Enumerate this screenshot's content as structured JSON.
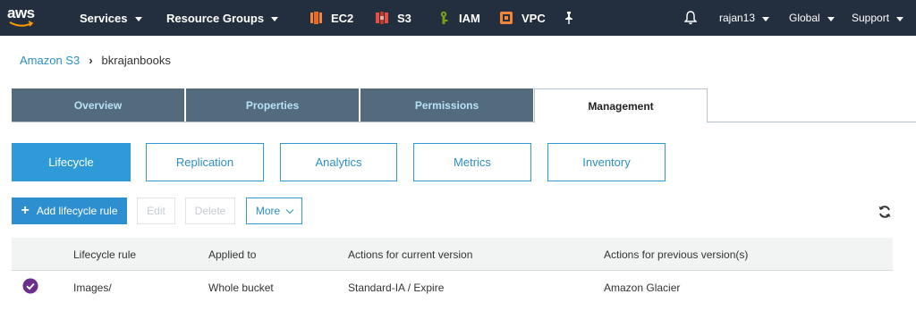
{
  "nav": {
    "logo": "aws",
    "services_label": "Services",
    "resource_groups_label": "Resource Groups",
    "shortcuts": [
      {
        "label": "EC2",
        "icon": "ec2-icon"
      },
      {
        "label": "S3",
        "icon": "s3-icon"
      },
      {
        "label": "IAM",
        "icon": "iam-icon"
      },
      {
        "label": "VPC",
        "icon": "vpc-icon"
      }
    ],
    "pin_icon": "pin-icon",
    "bell_icon": "bell-icon",
    "user_label": "rajan13",
    "region_label": "Global",
    "support_label": "Support"
  },
  "breadcrumb": {
    "root": "Amazon S3",
    "current": "bkrajanbooks"
  },
  "tabs": [
    {
      "label": "Overview",
      "active": false
    },
    {
      "label": "Properties",
      "active": false
    },
    {
      "label": "Permissions",
      "active": false
    },
    {
      "label": "Management",
      "active": true
    }
  ],
  "subtabs": [
    {
      "label": "Lifecycle",
      "active": true
    },
    {
      "label": "Replication",
      "active": false
    },
    {
      "label": "Analytics",
      "active": false
    },
    {
      "label": "Metrics",
      "active": false
    },
    {
      "label": "Inventory",
      "active": false
    }
  ],
  "toolbar": {
    "add_label": "Add lifecycle rule",
    "edit_label": "Edit",
    "delete_label": "Delete",
    "more_label": "More",
    "refresh_icon": "refresh-icon"
  },
  "table": {
    "headers": [
      "Lifecycle rule",
      "Applied to",
      "Actions for current version",
      "Actions for previous version(s)"
    ],
    "rows": [
      {
        "selected": true,
        "rule": "Images/",
        "applied_to": "Whole bucket",
        "current": "Standard-IA / Expire",
        "previous": "Amazon Glacier"
      }
    ]
  },
  "colors": {
    "nav_bg": "#232f3e",
    "tab_bg": "#546a7d",
    "accent": "#2e9bd8",
    "ec2": "#f58536",
    "s3": "#e05243",
    "iam": "#7aa116",
    "vpc": "#f58536",
    "selected_check": "#6b2f8a"
  }
}
